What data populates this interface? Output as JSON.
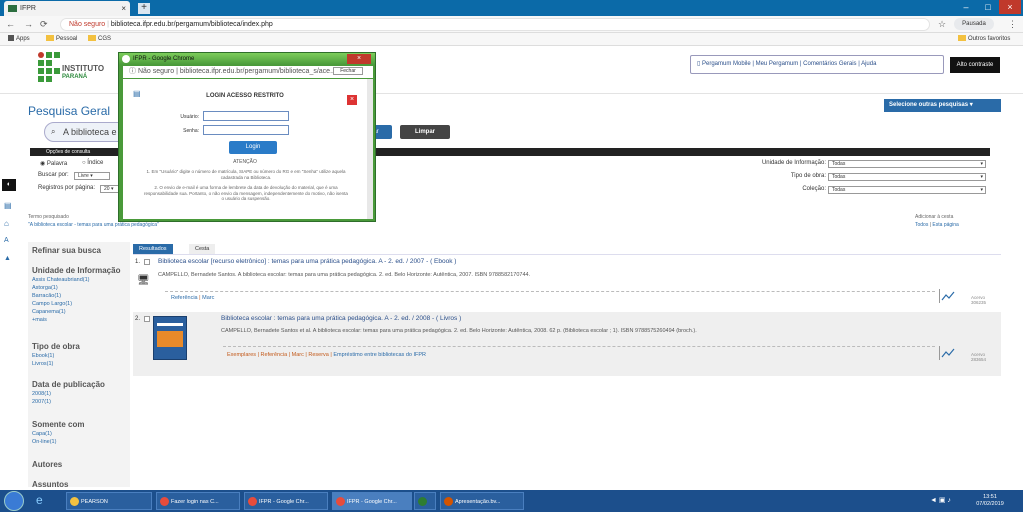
{
  "browser": {
    "tab_title": "IFPR",
    "tab_close": "×",
    "new_tab": "+",
    "security_label": "Não seguro",
    "url": "biblioteca.ifpr.edu.br/pergamum/biblioteca/index.php",
    "profile": "Pausada",
    "bookmarks": [
      "Apps",
      "Pessoal",
      "CGS"
    ],
    "other_bookmarks": "Outros favoritos"
  },
  "header": {
    "logo_text": "INSTITUTO",
    "logo_sub": "PARANÁ",
    "nav": [
      "Pergamum Mobile",
      "Meu Pergamum",
      "Comentários Gerais",
      "Ajuda"
    ],
    "contrast": "Alto contraste"
  },
  "search": {
    "title": "Pesquisa Geral",
    "query": "A biblioteca e",
    "buscar": "ar",
    "limpar": "Limpar",
    "selecionar": "Selecione outras pesquisas",
    "options_title": "Opções de consulta",
    "palavra": "Palavra",
    "indice": "Índice",
    "buscar_por_label": "Buscar por:",
    "buscar_por_value": "Livre",
    "registros_label": "Registros por página:",
    "registros_value": "20",
    "unidade_label": "Unidade de Informação:",
    "unidade_value": "Todas",
    "tipo_label": "Tipo de obra:",
    "tipo_value": "Todas",
    "colecao_label": "Coleção:",
    "colecao_value": "Todas"
  },
  "termo": {
    "label": "Termo pesquisado",
    "value": "\"A biblioteca escolar - temas para uma prática pedagógica\"",
    "adicionar": "Adicionar à cesta",
    "todos": "Todos",
    "esta_pagina": "Esta página"
  },
  "sidebar": {
    "title": "Refinar sua busca",
    "unidade": "Unidade de Informação",
    "unidade_items": [
      "Assis Chateaubriand(1)",
      "Astorga(1)",
      "Barracão(1)",
      "Campo Largo(1)",
      "Capanema(1)",
      "+mais"
    ],
    "tipo": "Tipo de obra",
    "tipo_items": [
      "Ebook(1)",
      "Livros(1)"
    ],
    "data": "Data de publicação",
    "data_items": [
      "2008(1)",
      "2007(1)"
    ],
    "somente": "Somente com",
    "somente_items": [
      "Capa(1)",
      "On-line(1)"
    ],
    "autores": "Autores",
    "assuntos": "Assuntos"
  },
  "results": {
    "tab_resultados": "Resultados \"2\"",
    "tab_cesta": "Cesta",
    "items": [
      {
        "num": "1.",
        "title": "Biblioteca escolar [recurso eletrônico] : temas para uma prática pedagógica. A - 2. ed. / 2007 - ( Ebook )",
        "desc": "CAMPELLO, Bernadete Santos. A biblioteca escolar: temas para uma prática pedagógica. 2. ed. Belo Horizonte: Autêntica, 2007. ISBN 9788582170744.",
        "links": [
          "Referência",
          "Marc"
        ],
        "reg_label": "Acervo",
        "reg": "306235"
      },
      {
        "num": "2.",
        "title": "Biblioteca escolar : temas para uma prática pedagógica. A - 2. ed. / 2008 - ( Livros )",
        "desc": "CAMPELLO, Bernadete Santos et al. A biblioteca escolar: temas para uma prática pedagógica. 2. ed. Belo Horizonte: Autêntica, 2008. 62 p. (Biblioteca escolar ; 1). ISBN 9788575260494 (broch.).",
        "links": [
          "Exemplares",
          "Referência",
          "Marc",
          "Reserva",
          "Empréstimo entre bibliotecas do IFPR"
        ],
        "reg_label": "Acervo",
        "reg": "283654"
      }
    ]
  },
  "modal": {
    "window_title": "IFPR - Google Chrome",
    "security_label": "Não seguro",
    "url": "biblioteca.ifpr.edu.br/pergamum/biblioteca_s/ace...",
    "fechar": "Fechar",
    "login_title": "LOGIN ACESSO RESTRITO",
    "usuario_label": "Usuário:",
    "senha_label": "Senha:",
    "login_button": "Login",
    "atencao": "ATENÇÃO",
    "note1": "1. Em \"Usuário\" digite o número de matrícula, SIAPE ou número do RG e em \"Senha\" utilize aquela cadastrada na Biblioteca.",
    "note2": "2. O envio de e-mail é uma forma de lembrete da data de devolução do material, que é uma responsabilidade sua. Portanto, o não envio da mensagem, independentemente do motivo, não isenta o usuário da suspensão."
  },
  "taskbar": {
    "items": [
      "PEARSON",
      "Fazer login nas C...",
      "IFPR - Google Chr...",
      "IFPR - Google Chr...",
      "",
      "Apresentação.bv..."
    ],
    "time": "13:51",
    "date": "07/02/2019"
  },
  "colors": {
    "accent": "#2a6ba8",
    "taskbar": "#1c4f8c",
    "modal_frame": "#4a9a3a"
  }
}
